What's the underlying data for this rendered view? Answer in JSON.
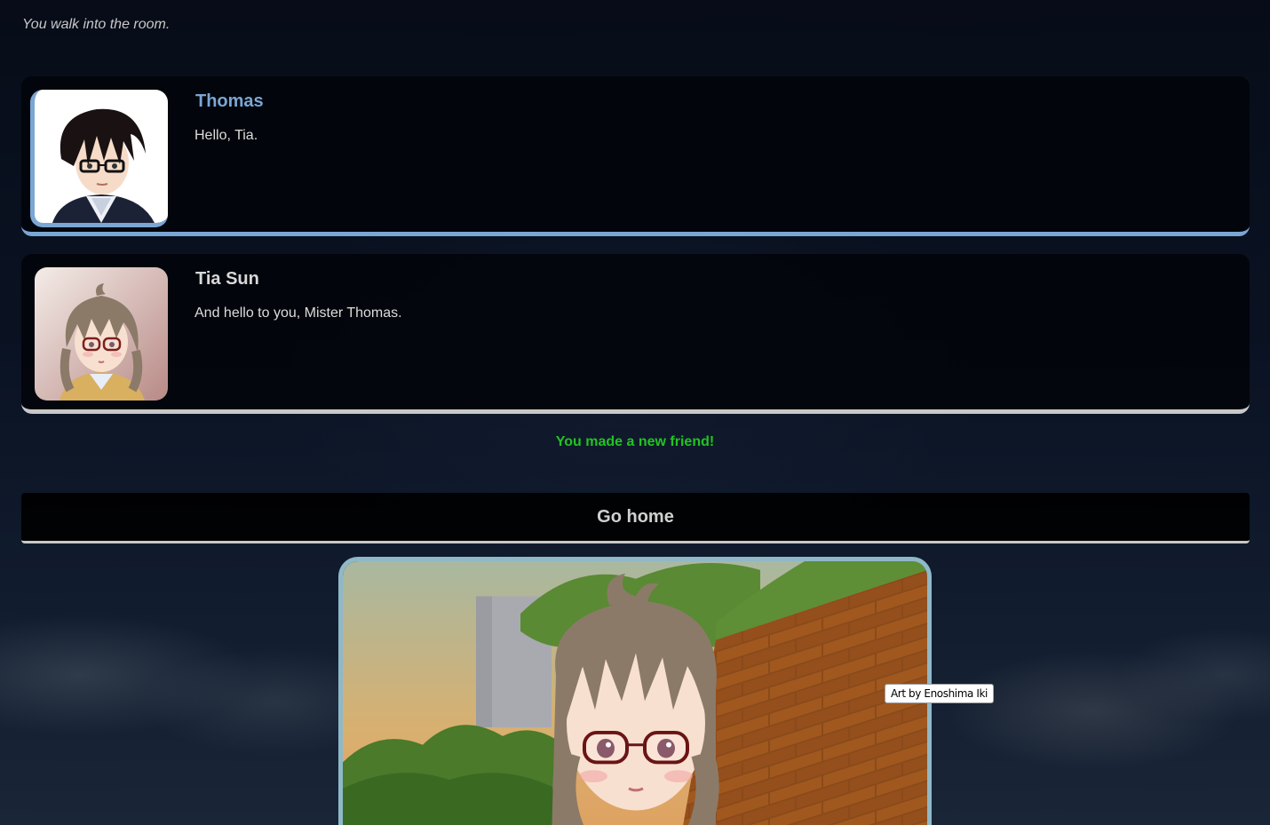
{
  "narration": "You walk into the room.",
  "dialog": [
    {
      "speaker": "Thomas",
      "text": "Hello, Tia.",
      "accent": "#7aa6d4",
      "portrait_icon": "thomas-portrait"
    },
    {
      "speaker": "Tia Sun",
      "text": "And hello to you, Mister Thomas.",
      "accent": "#c8c8c8",
      "portrait_icon": "tia-sun-portrait"
    }
  ],
  "event_message": "You made a new friend!",
  "event_color": "#22c322",
  "choices": [
    {
      "label": "Go home"
    }
  ],
  "scene": {
    "credit": "Art by Enoshima Iki",
    "frame_color": "#8fb8c8"
  }
}
